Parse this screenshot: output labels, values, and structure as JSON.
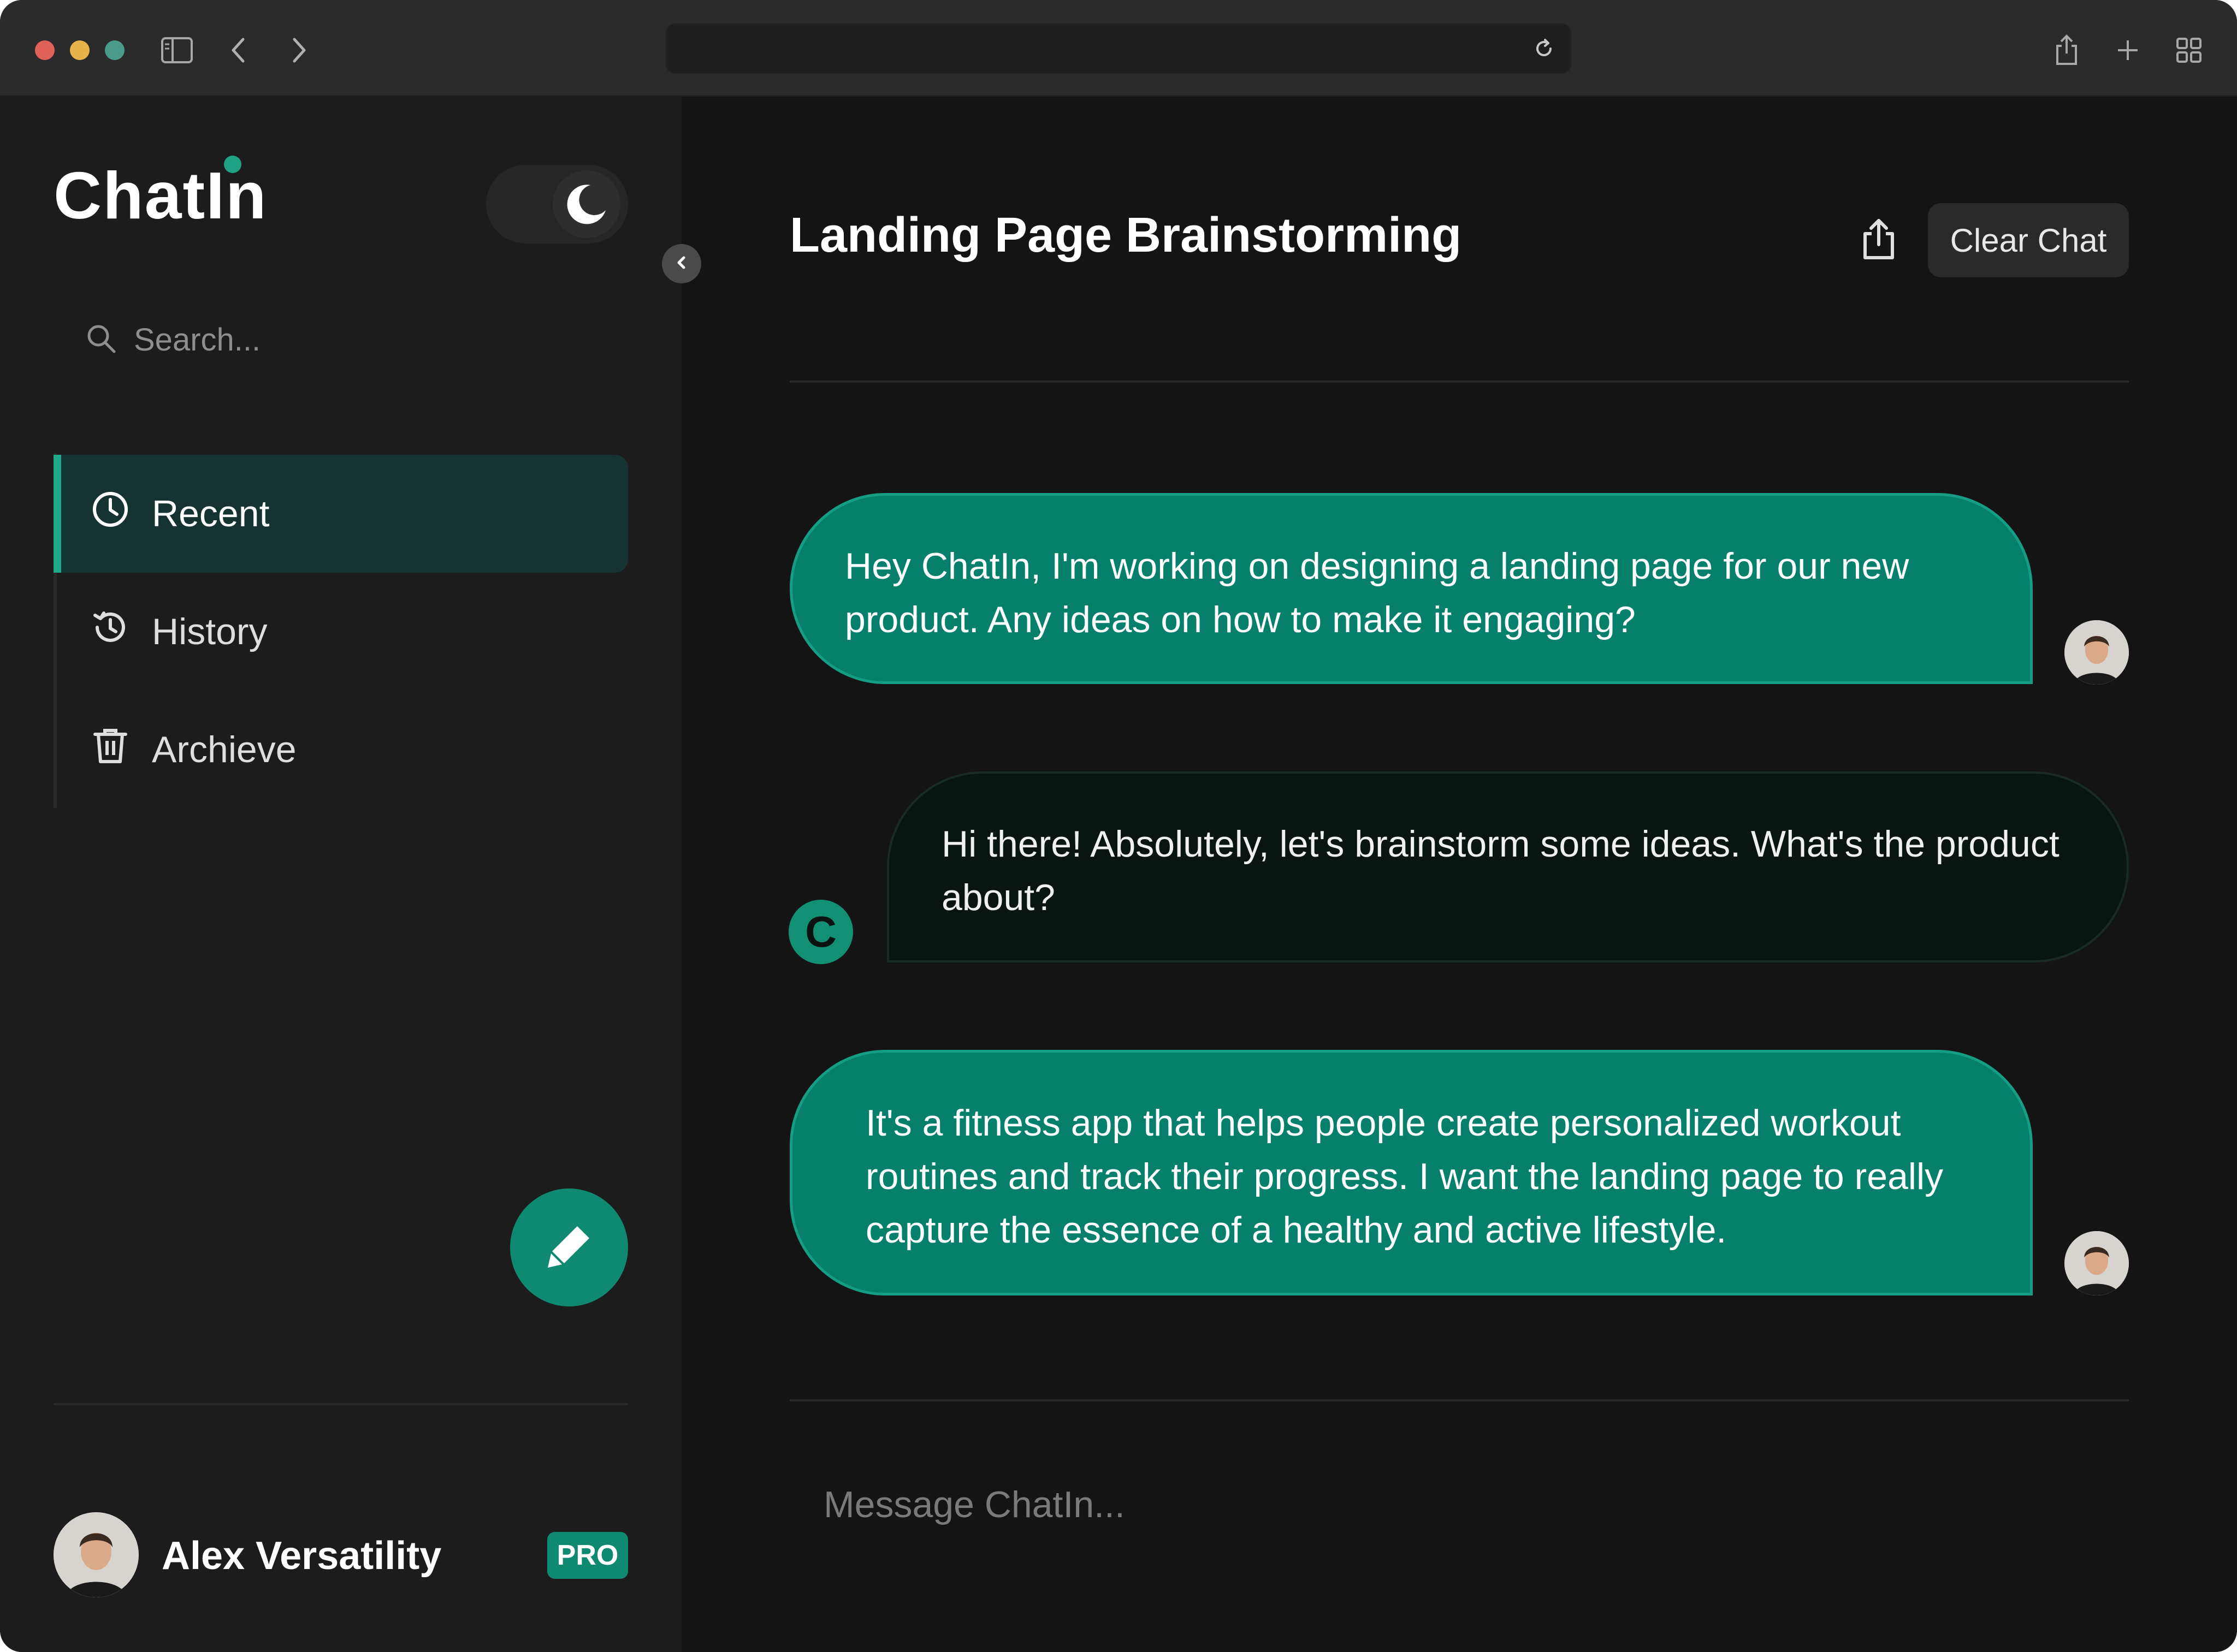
{
  "app": {
    "logo_text": "ChatIn",
    "theme_mode": "dark",
    "accent_color": "#0f8a70"
  },
  "browser": {
    "icons": [
      "sidebar-icon",
      "back-icon",
      "forward-icon",
      "reload-icon",
      "share-icon",
      "new-tab-icon",
      "tab-overview-icon"
    ]
  },
  "sidebar": {
    "search_placeholder": "Search...",
    "items": [
      {
        "label": "Recent",
        "icon": "clock-icon",
        "active": true
      },
      {
        "label": "History",
        "icon": "history-icon",
        "active": false
      },
      {
        "label": "Archieve",
        "icon": "trash-icon",
        "active": false
      }
    ],
    "new_chat_icon": "pencil-icon",
    "user": {
      "name": "Alex Versatility",
      "badge": "PRO"
    }
  },
  "chat": {
    "title": "Landing Page Brainstorming",
    "clear_label": "Clear Chat",
    "bot_avatar_letter": "C",
    "messages": [
      {
        "role": "user",
        "text": "Hey ChatIn, I'm working on designing a landing page for our new product. Any ideas on how to make it engaging?"
      },
      {
        "role": "bot",
        "text": "Hi there! Absolutely, let's brainstorm some ideas. What's the product about?"
      },
      {
        "role": "user",
        "text": "It's a fitness app that helps people create personalized workout routines and track their progress. I want the landing page to really capture the essence of a healthy and active lifestyle."
      }
    ],
    "composer_placeholder": "Message ChatIn..."
  }
}
